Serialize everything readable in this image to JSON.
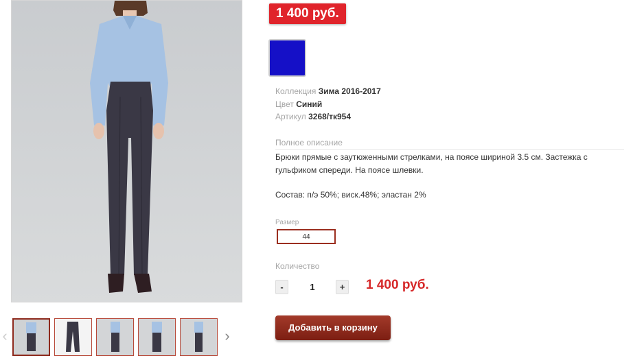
{
  "product": {
    "price_badge": "1 400 руб.",
    "color_swatch": "#1510c7",
    "meta": [
      {
        "key": "Коллекция",
        "value": "Зима 2016-2017"
      },
      {
        "key": "Цвет",
        "value": "Синий"
      },
      {
        "key": "Артикул",
        "value": "3268/тк954"
      }
    ],
    "description_label": "Полное описание",
    "description_text": "Брюки прямые с заутюженными стрелками, на поясе шириной 3.5 см. Застежка с гульфиком спереди. На поясе шлевки.",
    "composition": "Состав: п/э 50%; виск.48%; эластан 2%",
    "size_label": "Размер",
    "size_value": "44",
    "quantity_label": "Количество",
    "quantity_minus": "-",
    "quantity_value": "1",
    "quantity_plus": "+",
    "total_price": "1 400 руб.",
    "add_to_cart": "Добавить в корзину"
  },
  "gallery": {
    "prev_icon": "‹",
    "next_icon": "›",
    "thumbnails": [
      "full-outfit-front",
      "trousers-flat",
      "outfit-side",
      "outfit-front-2",
      "outfit-back"
    ]
  },
  "colors": {
    "accent_red": "#e0242b",
    "button_dark_red": "#8e2a1d",
    "swatch_blue": "#1510c7"
  }
}
